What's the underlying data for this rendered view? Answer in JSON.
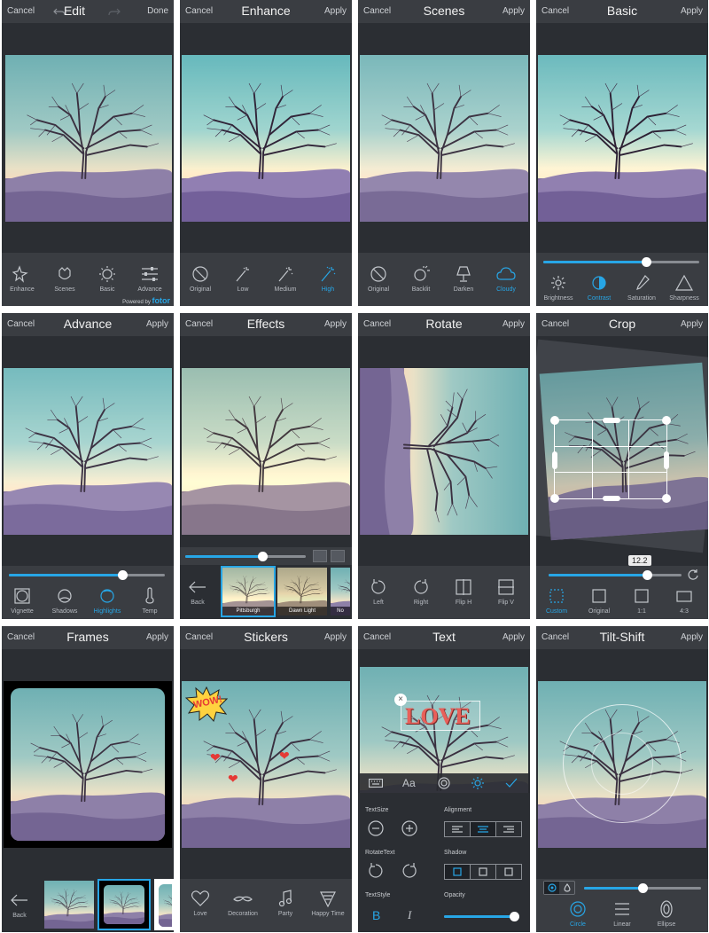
{
  "panels": {
    "edit": {
      "cancel": "Cancel",
      "title": "Edit",
      "done": "Done",
      "tools": [
        "Enhance",
        "Scenes",
        "Basic",
        "Advance"
      ],
      "powered": "Powered by",
      "brand": "fotor"
    },
    "enhance": {
      "cancel": "Cancel",
      "title": "Enhance",
      "apply": "Apply",
      "tools": [
        "Original",
        "Low",
        "Medium",
        "High"
      ],
      "active": "High"
    },
    "scenes": {
      "cancel": "Cancel",
      "title": "Scenes",
      "apply": "Apply",
      "tools": [
        "Original",
        "Backlit",
        "Darken",
        "Cloudy"
      ],
      "active": "Cloudy"
    },
    "basic": {
      "cancel": "Cancel",
      "title": "Basic",
      "apply": "Apply",
      "tools": [
        "Brightness",
        "Contrast",
        "Saturation",
        "Sharpness"
      ],
      "active": "Contrast",
      "slider_value": 0.66
    },
    "advance": {
      "cancel": "Cancel",
      "title": "Advance",
      "apply": "Apply",
      "tools": [
        "Vignette",
        "Shadows",
        "Highlights",
        "Temp"
      ],
      "active": "Highlights",
      "slider_value": 0.73
    },
    "effects": {
      "cancel": "Cancel",
      "title": "Effects",
      "apply": "Apply",
      "back": "Back",
      "thumbs": [
        "Pittsburgh",
        "Dawn Light",
        "No"
      ],
      "selected": "Pittsburgh",
      "slider_value": 0.64
    },
    "rotate": {
      "cancel": "Cancel",
      "title": "Rotate",
      "apply": "Apply",
      "tools": [
        "Left",
        "Right",
        "Flip H",
        "Flip V"
      ]
    },
    "crop": {
      "cancel": "Cancel",
      "title": "Crop",
      "apply": "Apply",
      "angle": "12.2",
      "tools": [
        "Custom",
        "Original",
        "1:1",
        "4:3"
      ],
      "active": "Custom",
      "slider_value": 0.74
    },
    "frames": {
      "cancel": "Cancel",
      "title": "Frames",
      "apply": "Apply",
      "back": "Back"
    },
    "stickers": {
      "cancel": "Cancel",
      "title": "Stickers",
      "apply": "Apply",
      "tools": [
        "Love",
        "Decoration",
        "Party",
        "Happy Time"
      ],
      "sticker_text": "WOW!"
    },
    "text": {
      "cancel": "Cancel",
      "title": "Text",
      "apply": "Apply",
      "overlay_text": "LOVE",
      "font_btn": "Aa",
      "labels": {
        "textsize": "TextSize",
        "alignment": "Alignment",
        "rotatetext": "RotateText",
        "shadow": "Shadow",
        "textstyle": "TextStyle",
        "opacity": "Opacity"
      },
      "bold": "B",
      "italic": "I",
      "opacity_value": 0.95
    },
    "tiltshift": {
      "cancel": "Cancel",
      "title": "Tilt-Shift",
      "apply": "Apply",
      "tools": [
        "Circle",
        "Linear",
        "Ellipse"
      ],
      "active": "Circle",
      "slider_value": 0.5
    }
  },
  "colors": {
    "accent": "#27a6e6",
    "nav_bg": "#3a3d42",
    "panel_bg": "#2b2e33"
  }
}
